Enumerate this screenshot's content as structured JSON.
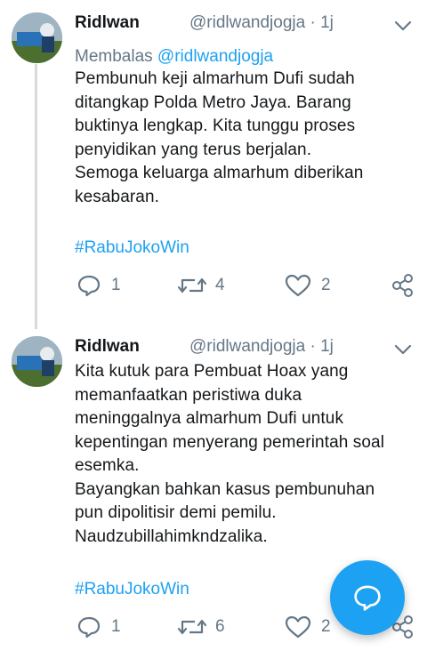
{
  "tweets": [
    {
      "name": "Ridlwan",
      "handle_time": "@ridlwandjogja · 1j",
      "reply_prefix": "Membalas ",
      "reply_mention": "@ridlwandjogja",
      "text": "Pembunuh keji almarhum Dufi sudah\nditangkap Polda Metro Jaya. Barang\nbuktinya lengkap. Kita tunggu proses\npenyidikan yang terus berjalan.\nSemoga keluarga almarhum diberikan\nkesabaran.",
      "hashtag": "#RabuJokoWin",
      "replies": "1",
      "retweets": "4",
      "likes": "2"
    },
    {
      "name": "Ridlwan",
      "handle_time": "@ridlwandjogja · 1j",
      "text": "Kita kutuk para Pembuat Hoax yang\nmemanfaatkan peristiwa duka\nmeninggalnya almarhum Dufi untuk\nkepentingan menyerang pemerintah soal\nesemka.\nBayangkan bahkan kasus pembunuhan\npun dipolitisir demi pemilu.\nNaudzubillahimkndzalika.",
      "hashtag": "#RabuJokoWin",
      "replies": "1",
      "retweets": "6",
      "likes": "2"
    }
  ],
  "colors": {
    "accent": "#1da1f2",
    "secondary_text": "#657786",
    "primary_text": "#14171a"
  },
  "icons": [
    "reply-icon",
    "retweet-icon",
    "like-icon",
    "share-icon",
    "chevron-down-icon",
    "compose-reply-icon"
  ]
}
